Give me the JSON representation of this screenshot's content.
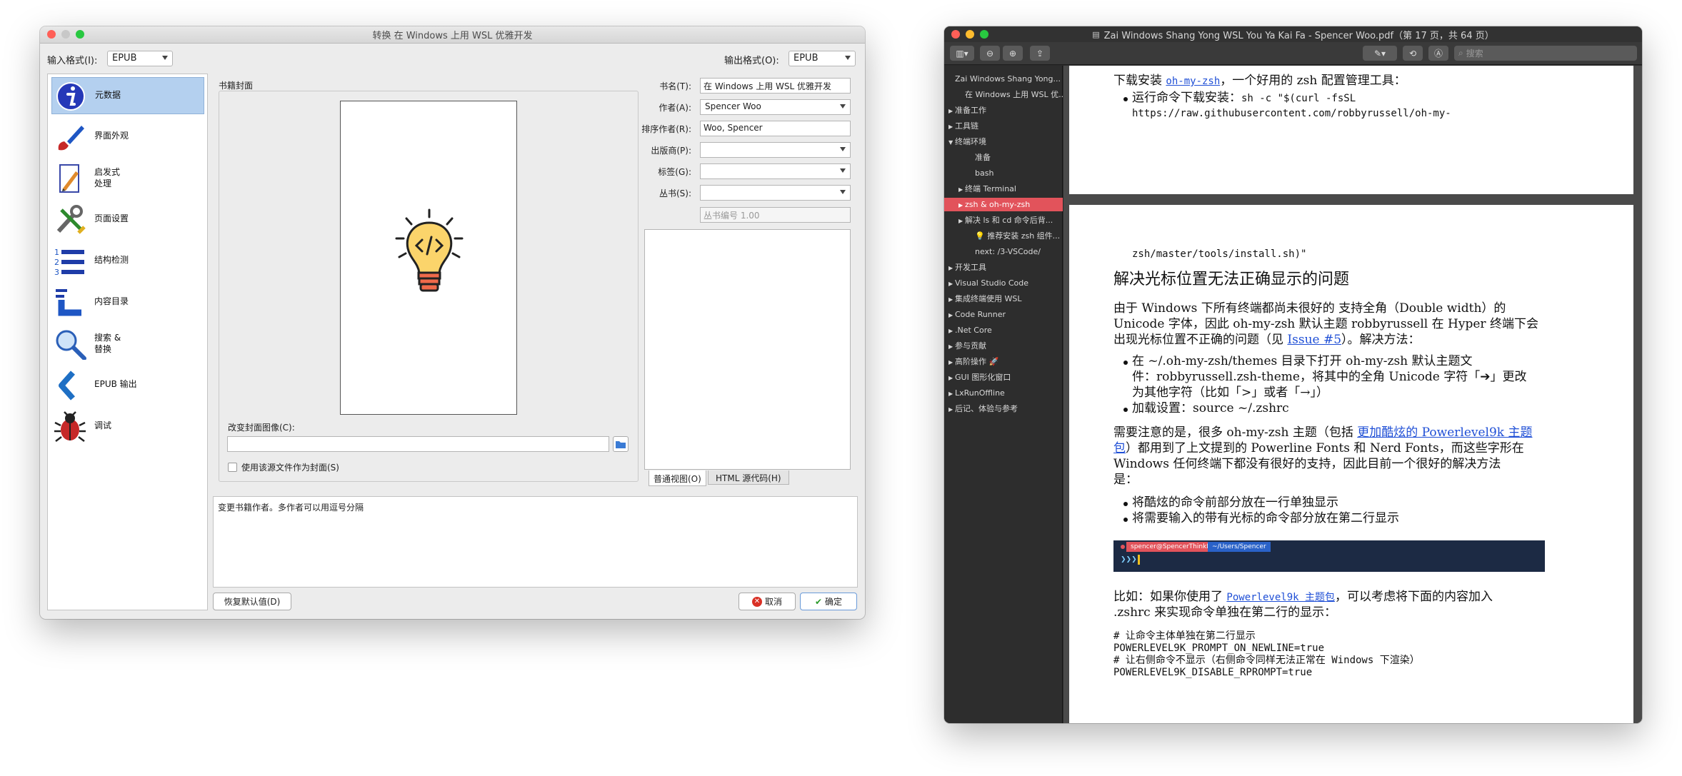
{
  "calibre": {
    "title": "转换 在 Windows 上用 WSL 优雅开发",
    "input_format_label": "输入格式(I):",
    "input_format": "EPUB",
    "output_format_label": "输出格式(O):",
    "output_format": "EPUB",
    "sidebar": [
      {
        "label": "元数据",
        "icon": "info-icon"
      },
      {
        "label": "界面外观",
        "icon": "paintbrush-icon"
      },
      {
        "label": "启发式\n处理",
        "icon": "pencil-doc-icon"
      },
      {
        "label": "页面设置",
        "icon": "tools-icon"
      },
      {
        "label": "结构检测",
        "icon": "numbered-list-icon"
      },
      {
        "label": "内容目录",
        "icon": "toc-icon"
      },
      {
        "label": "搜索 &\n替换",
        "icon": "magnifier-icon"
      },
      {
        "label": "EPUB 输出",
        "icon": "chevron-left-icon"
      },
      {
        "label": "调试",
        "icon": "bug-icon"
      }
    ],
    "cover_group_label": "书籍封面",
    "change_cover_label": "改变封面图像(C):",
    "use_source_cover_label": "使用该源文件作为封面(S)",
    "fields": {
      "title_label": "书名(T):",
      "title": "在 Windows 上用 WSL 优雅开发",
      "author_label": "作者(A):",
      "author": "Spencer Woo",
      "author_sort_label": "排序作者(R):",
      "author_sort": "Woo, Spencer",
      "publisher_label": "出版商(P):",
      "tags_label": "标签(G):",
      "series_label": "丛书(S):",
      "series_index": "丛书编号 1.00"
    },
    "tab_normal": "普通视图(O)",
    "tab_html": "HTML 源代码(H)",
    "help_text": "变更书籍作者。多作者可以用逗号分隔",
    "restore_defaults": "恢复默认值(D)",
    "cancel": "取消",
    "ok": "确定"
  },
  "preview": {
    "title": "Zai Windows Shang Yong WSL You Ya Kai Fa - Spencer Woo.pdf（第 17 页，共 64 页）",
    "search_placeholder": "搜索",
    "toc": [
      {
        "label": "Zai Windows Shang Yong...",
        "indent": 0,
        "arrow": ""
      },
      {
        "label": "在 Windows 上用 WSL 优...",
        "indent": 1,
        "arrow": ""
      },
      {
        "label": "准备工作",
        "indent": 0,
        "arrow": "▶"
      },
      {
        "label": "工具链",
        "indent": 0,
        "arrow": "▶"
      },
      {
        "label": "终端环境",
        "indent": 0,
        "arrow": "▼"
      },
      {
        "label": "准备",
        "indent": 2,
        "arrow": ""
      },
      {
        "label": "bash",
        "indent": 2,
        "arrow": ""
      },
      {
        "label": "终端 Terminal",
        "indent": 1,
        "arrow": "▶"
      },
      {
        "label": "zsh & oh-my-zsh",
        "indent": 1,
        "arrow": "▶",
        "selected": true
      },
      {
        "label": "解决 ls 和 cd 命令后背...",
        "indent": 1,
        "arrow": "▶"
      },
      {
        "label": "💡 推荐安装 zsh 组件...",
        "indent": 2,
        "arrow": ""
      },
      {
        "label": "next: /3-VSCode/",
        "indent": 2,
        "arrow": ""
      },
      {
        "label": "开发工具",
        "indent": 0,
        "arrow": "▶"
      },
      {
        "label": "Visual Studio Code",
        "indent": 0,
        "arrow": "▶"
      },
      {
        "label": "集成终端使用 WSL",
        "indent": 0,
        "arrow": "▶"
      },
      {
        "label": "Code Runner",
        "indent": 0,
        "arrow": "▶"
      },
      {
        "label": ".Net Core",
        "indent": 0,
        "arrow": "▶"
      },
      {
        "label": "参与贡献",
        "indent": 0,
        "arrow": "▶"
      },
      {
        "label": "高阶操作 🚀",
        "indent": 0,
        "arrow": "▶"
      },
      {
        "label": "GUI 图形化窗口",
        "indent": 0,
        "arrow": "▶"
      },
      {
        "label": "LxRunOffline",
        "indent": 0,
        "arrow": "▶"
      },
      {
        "label": "后记、体验与参考",
        "indent": 0,
        "arrow": "▶"
      }
    ],
    "page1": {
      "line1_pre": "下载安装 ",
      "line1_link": "oh-my-zsh",
      "line1_post": "，一个好用的 zsh 配置管理工具：",
      "bullet_pre": "运行命令下载安装：",
      "bullet_code": "sh -c \"$(curl -fsSL",
      "bullet_code2": "https://raw.githubusercontent.com/robbyrussell/oh-my-"
    },
    "page2": {
      "code_cont": "zsh/master/tools/install.sh)\"",
      "heading": "解决光标位置无法正确显示的问题",
      "p1_l1": "由于  Windows  下所有终端都尚未很好的  支持全角（Double  width）的",
      "p1_l2": "Unicode 字体，因此 oh-my-zsh 默认主题 robbyrussell 在 Hyper 终端下会",
      "p1_l3_pre": "出现光标位置不正确的问题（见 ",
      "p1_l3_link": "Issue #5",
      "p1_l3_post": "）。解决方法：",
      "b1_l1": "在    ~/.oh-my-zsh/themes    目录下打开    oh-my-zsh    默认主题文",
      "b1_l2": "件：robbyrussell.zsh-theme，将其中的全角 Unicode 字符「➔」更改",
      "b1_l3": "为其他字符（比如「>」或者「→」）",
      "b2": "加载设置：source ~/.zshrc",
      "p2_l1_pre": "需要注意的是，很多 oh-my-zsh 主题（包括 ",
      "p2_l1_link": "更加酷炫的 Powerlevel9k 主题",
      "p2_l2_link": "包",
      "p2_l2_post": "）都用到了上文提到的 Powerline Fonts 和 Nerd Fonts，而这些字形在",
      "p2_l3": "Windows      任何终端下都没有很好的支持，因此目前一个很好的解决方法",
      "p2_l4": "是：",
      "b3": "将酷炫的命令前部分放在一行单独显示",
      "b4": "将需要输入的带有光标的命令部分放在第二行显示",
      "prompt_user": "spencer@SpencerThinkPad",
      "prompt_path": "~/Users/Spencer",
      "p3_l1_pre": "比如：如果你使用了 ",
      "p3_l1_link": "Powerlevel9k 主题包",
      "p3_l1_post": "，可以考虑将下面的内容加入",
      "p3_l2": ".zshrc 来实现命令单独在第二行的显示：",
      "c1": "# 让命令主体单独在第二行显示",
      "c2": "POWERLEVEL9K_PROMPT_ON_NEWLINE=true",
      "c3": "# 让右侧命令不显示（右侧命令同样无法正常在 Windows 下渲染）",
      "c4": "POWERLEVEL9K_DISABLE_RPROMPT=true"
    }
  },
  "colors": {
    "accent": "#b4d0ef",
    "toc_selected": "#e2535b",
    "link": "#1f4fd6",
    "close": "#ff5f57",
    "minimize": "#febc2e",
    "zoom": "#28c840"
  }
}
